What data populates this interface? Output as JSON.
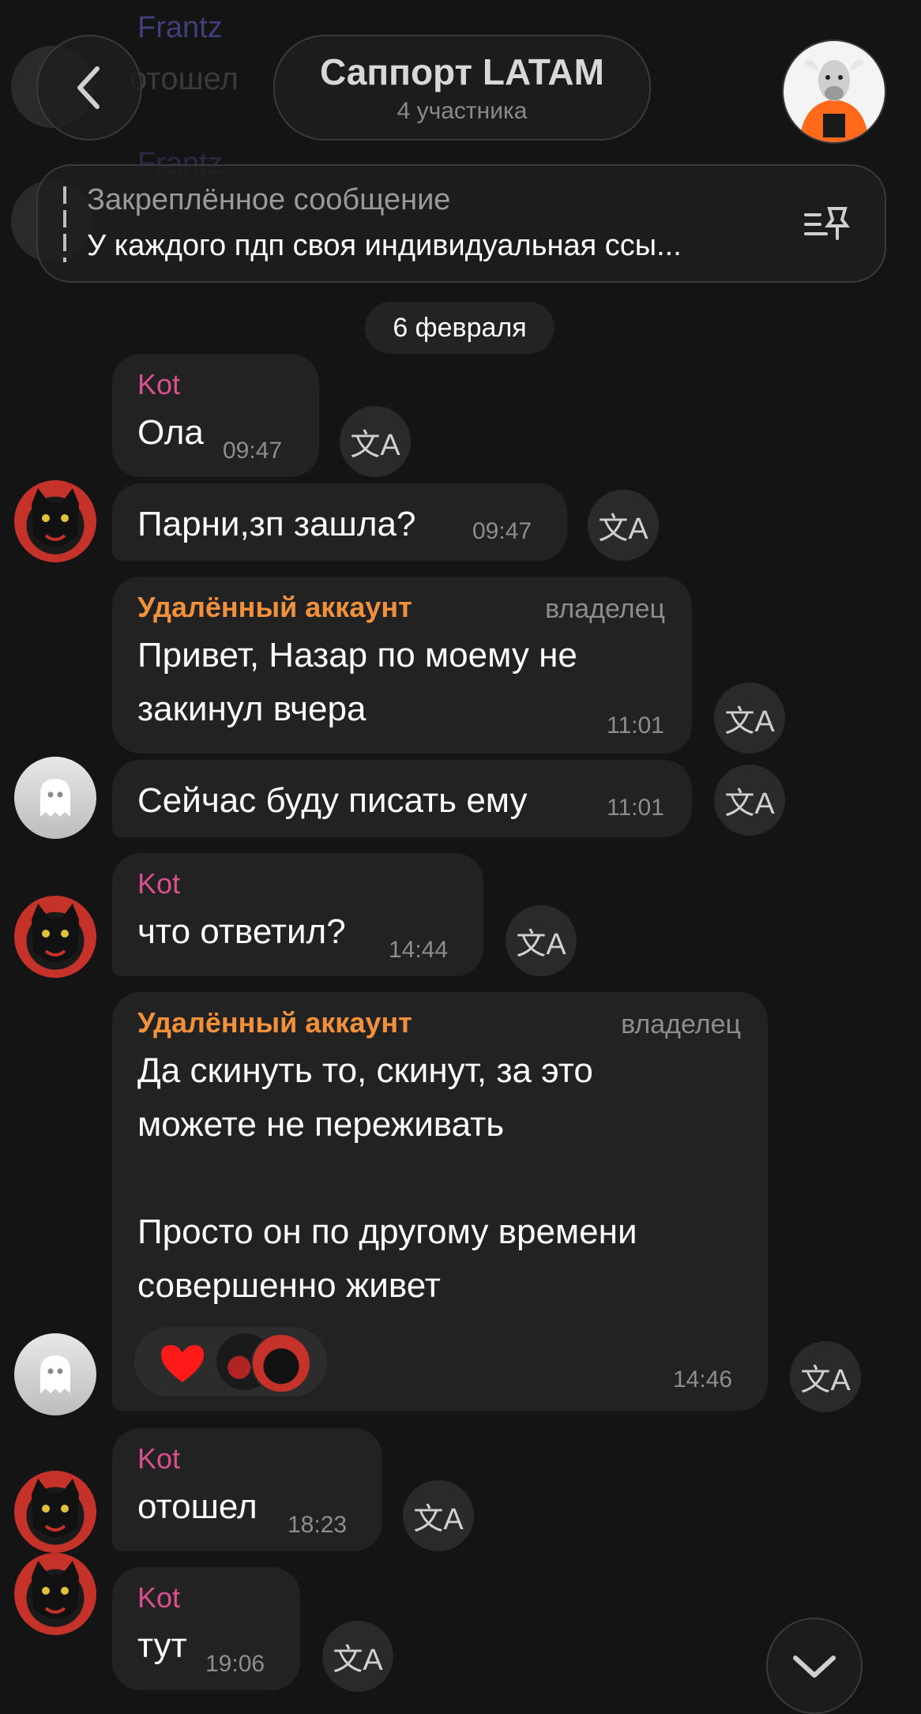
{
  "background_messages": {
    "name_1": "Frantz",
    "text_1": "отошел",
    "name_2": "Frantz"
  },
  "header": {
    "title": "Саппорт LATAM",
    "subtitle": "4 участника"
  },
  "pinned": {
    "heading": "Закреплённое сообщение",
    "text": "У каждого пдп своя индивидуальная ссы..."
  },
  "date_separator": "6 февраля",
  "messages": [
    {
      "sender": "Kot",
      "text": "Ола",
      "time": "09:47"
    },
    {
      "sender": "",
      "text": "Парни,зп зашла?",
      "time": "09:47"
    },
    {
      "sender": "Удалённый аккаунт",
      "role": "владелец",
      "text": "Привет, Назар по моему не\nзакинул вчера",
      "time": "11:01"
    },
    {
      "sender": "",
      "text": "Сейчас буду писать ему",
      "time": "11:01"
    },
    {
      "sender": "Kot",
      "text": "что ответил?",
      "time": "14:44"
    },
    {
      "sender": "Удалённый аккаунт",
      "role": "владелец",
      "text": "Да скинуть то, скинут, за это\nможете не переживать\n\nПросто он по другому времени\nсовершенно живет",
      "time": "14:46",
      "reaction": "heart"
    },
    {
      "sender": "Kot",
      "text": "отошел",
      "time": "18:23"
    },
    {
      "sender": "Kot",
      "text": "тут",
      "time": "19:06"
    }
  ],
  "colors": {
    "background": "#141414",
    "bubble": "#222222",
    "kot_name": "#d9508e",
    "owner_name": "#f2913b",
    "time": "#8d8d8d"
  },
  "icons": [
    "back-chevron-icon",
    "pin-list-icon",
    "translate-icon",
    "ghost-icon",
    "heart-icon",
    "chevron-down-icon"
  ]
}
